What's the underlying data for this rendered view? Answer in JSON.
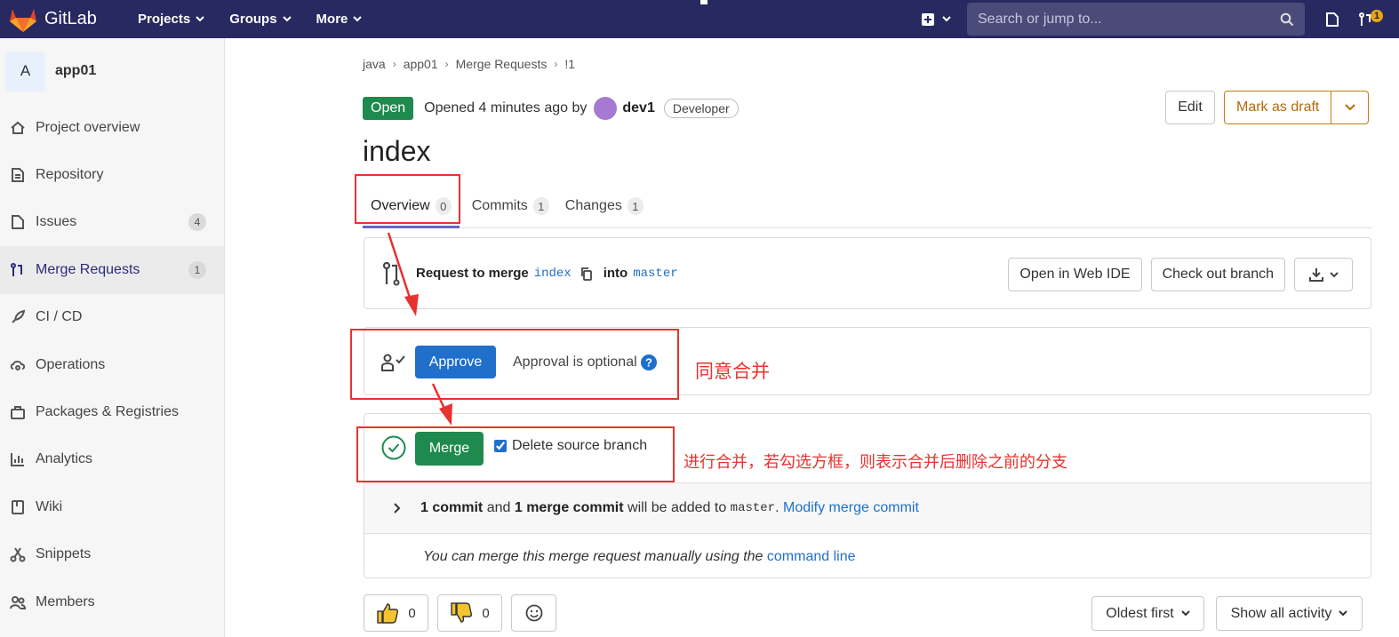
{
  "topbar": {
    "brand": "GitLab",
    "nav": [
      "Projects",
      "Groups",
      "More"
    ],
    "search_placeholder": "Search or jump to...",
    "mr_badge": "1"
  },
  "sidebar": {
    "project_initial": "A",
    "project_name": "app01",
    "items": [
      {
        "label": "Project overview",
        "icon": "home-icon"
      },
      {
        "label": "Repository",
        "icon": "document-icon"
      },
      {
        "label": "Issues",
        "icon": "issues-icon",
        "count": "4"
      },
      {
        "label": "Merge Requests",
        "icon": "merge-request-icon",
        "count": "1",
        "active": true
      },
      {
        "label": "CI / CD",
        "icon": "rocket-icon"
      },
      {
        "label": "Operations",
        "icon": "cloud-gear-icon"
      },
      {
        "label": "Packages & Registries",
        "icon": "package-icon"
      },
      {
        "label": "Analytics",
        "icon": "chart-icon"
      },
      {
        "label": "Wiki",
        "icon": "book-icon"
      },
      {
        "label": "Snippets",
        "icon": "scissors-icon"
      },
      {
        "label": "Members",
        "icon": "users-icon"
      }
    ]
  },
  "breadcrumb": [
    "java",
    "app01",
    "Merge Requests",
    "!1"
  ],
  "mr": {
    "status": "Open",
    "opened": "Opened 4 minutes ago by",
    "author": "dev1",
    "role": "Developer",
    "edit_label": "Edit",
    "draft_label": "Mark as draft",
    "title": "index",
    "tabs": [
      {
        "label": "Overview",
        "count": "0"
      },
      {
        "label": "Commits",
        "count": "1"
      },
      {
        "label": "Changes",
        "count": "1"
      }
    ],
    "request_prefix": "Request to merge",
    "source_branch": "index",
    "into": "into",
    "target_branch": "master",
    "web_ide_label": "Open in Web IDE",
    "checkout_label": "Check out branch",
    "approve_label": "Approve",
    "approval_text": "Approval is optional",
    "merge_label": "Merge",
    "delete_source_label": "Delete source branch",
    "commit_count": "1 commit",
    "and": "and",
    "merge_commit": "1 merge commit",
    "will_be_added": "will be added to",
    "target_mono": "master",
    "modify_link": "Modify merge commit",
    "manual_text": "You can merge this merge request manually using the",
    "command_line_link": "command line",
    "thumbs_up_count": "0",
    "thumbs_down_count": "0",
    "sort_label": "Oldest first",
    "activity_label": "Show all activity"
  },
  "annotations": {
    "approve_note": "同意合并",
    "merge_note": "进行合并，若勾选方框，则表示合并后删除之前的分支",
    "color": "#e8322f"
  }
}
